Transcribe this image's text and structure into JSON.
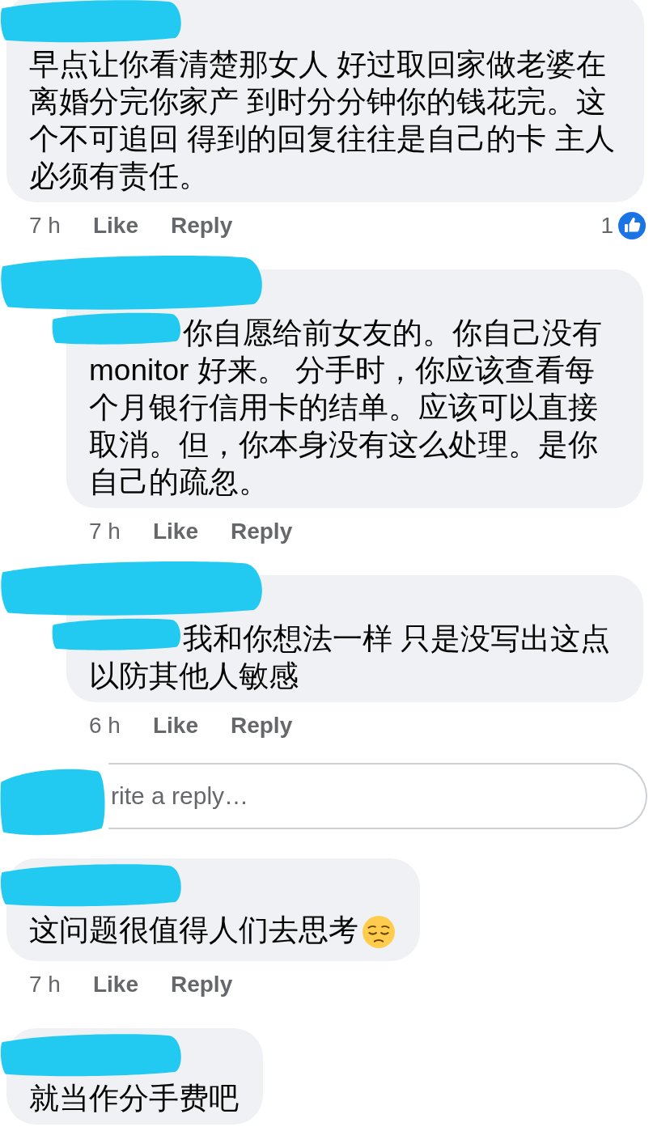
{
  "comments": [
    {
      "name_redacted": true,
      "text": "早点让你看清楚那女人 好过取回家做老婆在离婚分完你家产 到时分分钟你的钱花完。这个不可追回 得到的回复往往是自己的卡 主人必须有责任。",
      "time": "7 h",
      "actions": [
        "Like",
        "Reply"
      ],
      "reactions": {
        "count": "1"
      },
      "replies": [
        {
          "name_redacted": true,
          "mention_redacted": true,
          "text": "你自愿给前女友的。你自己没有 monitor 好来。 分手时，你应该查看每个月银行信用卡的结单。应该可以直接取消。但，你本身没有这么处理。是你自己的疏忽。",
          "time": "7 h",
          "actions": [
            "Like",
            "Reply"
          ]
        },
        {
          "name_redacted": true,
          "mention_redacted": true,
          "text": "我和你想法一样 只是没写出这点以防其他人敏感",
          "time": "6 h",
          "actions": [
            "Like",
            "Reply"
          ]
        }
      ],
      "reply_box": {
        "avatar_redacted": true,
        "placeholder": "rite a reply…"
      }
    },
    {
      "name_redacted": true,
      "text": "这问题很值得人们去思考",
      "emoji": true,
      "time": "7 h",
      "actions": [
        "Like",
        "Reply"
      ]
    },
    {
      "name_redacted": true,
      "text": "就当作分手费吧"
    }
  ]
}
